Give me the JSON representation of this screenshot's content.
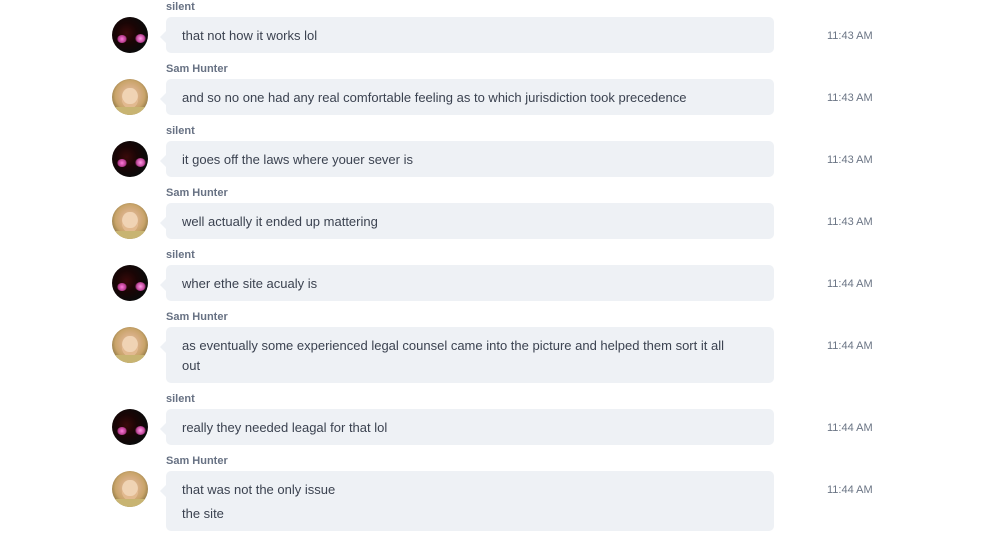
{
  "messages": [
    {
      "sender": "silent",
      "avatar": "silent",
      "lines": [
        "that not how it works lol"
      ],
      "time": "11:43 AM"
    },
    {
      "sender": "Sam Hunter",
      "avatar": "sam",
      "lines": [
        "and so no one had any real comfortable feeling as to which jurisdiction took precedence"
      ],
      "time": "11:43 AM"
    },
    {
      "sender": "silent",
      "avatar": "silent",
      "lines": [
        "it goes off the laws where youer sever is"
      ],
      "time": "11:43 AM"
    },
    {
      "sender": "Sam Hunter",
      "avatar": "sam",
      "lines": [
        "well actually it ended up mattering"
      ],
      "time": "11:43 AM"
    },
    {
      "sender": "silent",
      "avatar": "silent",
      "lines": [
        "wher ethe site acualy is"
      ],
      "time": "11:44 AM"
    },
    {
      "sender": "Sam Hunter",
      "avatar": "sam",
      "lines": [
        "as eventually some experienced legal counsel came into the picture and helped them sort it all",
        "out"
      ],
      "time": "11:44 AM"
    },
    {
      "sender": "silent",
      "avatar": "silent",
      "lines": [
        "really they needed leagal for that lol"
      ],
      "time": "11:44 AM"
    },
    {
      "sender": "Sam Hunter",
      "avatar": "sam",
      "lines": [
        "that was not the only issue",
        "the site"
      ],
      "time": "11:44 AM"
    }
  ]
}
